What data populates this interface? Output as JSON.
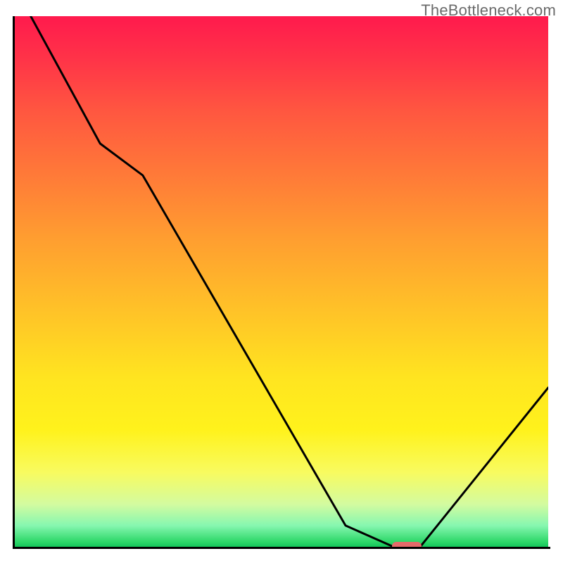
{
  "watermark": "TheBottleneck.com",
  "chart_data": {
    "type": "line",
    "title": "",
    "xlabel": "",
    "ylabel": "",
    "xlim": [
      0,
      100
    ],
    "ylim": [
      0,
      100
    ],
    "x": [
      0,
      3,
      16,
      24,
      62,
      71,
      76,
      100
    ],
    "values": [
      110,
      100,
      76,
      70,
      4,
      0,
      0,
      30
    ],
    "marker": {
      "x_start": 71,
      "x_end": 76,
      "y": 0
    },
    "grid": false,
    "legend": false,
    "background_gradient": {
      "top": "#ff1a4d",
      "mid": "#ffe420",
      "bottom": "#14c55a"
    }
  }
}
